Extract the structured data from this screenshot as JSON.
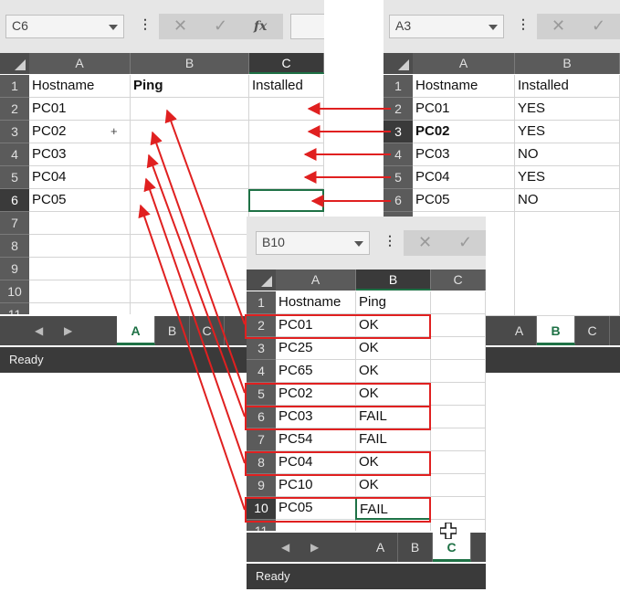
{
  "status_text": "Ready",
  "formula_icons": {
    "cancel": "✕",
    "enter": "✓",
    "fx": "fx"
  },
  "accent_color": "#1e7145",
  "arrow_color": "#e02020",
  "windows": {
    "A": {
      "name_box": "C6",
      "columns": [
        "A",
        "B",
        "C"
      ],
      "selected_column": "C",
      "rows": [
        {
          "num": "1",
          "cells": [
            "Hostname",
            "Ping",
            "Installed"
          ]
        },
        {
          "num": "2",
          "cells": [
            "PC01",
            "",
            ""
          ]
        },
        {
          "num": "3",
          "cells": [
            "PC02",
            "",
            ""
          ]
        },
        {
          "num": "4",
          "cells": [
            "PC03",
            "",
            ""
          ]
        },
        {
          "num": "5",
          "cells": [
            "PC04",
            "",
            ""
          ]
        },
        {
          "num": "6",
          "cells": [
            "PC05",
            "",
            ""
          ]
        },
        {
          "num": "7",
          "cells": [
            "",
            "",
            ""
          ]
        },
        {
          "num": "8",
          "cells": [
            "",
            "",
            ""
          ]
        },
        {
          "num": "9",
          "cells": [
            "",
            "",
            ""
          ]
        },
        {
          "num": "10",
          "cells": [
            "",
            "",
            ""
          ]
        },
        {
          "num": "11",
          "cells": [
            "",
            "",
            ""
          ]
        }
      ],
      "tabs": [
        "A",
        "B",
        "C"
      ],
      "active_tab": "A"
    },
    "B": {
      "name_box": "A3",
      "columns": [
        "A",
        "B"
      ],
      "rows": [
        {
          "num": "1",
          "cells": [
            "Hostname",
            "Installed"
          ]
        },
        {
          "num": "2",
          "cells": [
            "PC01",
            "YES"
          ]
        },
        {
          "num": "3",
          "cells": [
            "PC02",
            "YES"
          ]
        },
        {
          "num": "4",
          "cells": [
            "PC03",
            "NO"
          ]
        },
        {
          "num": "5",
          "cells": [
            "PC04",
            "YES"
          ]
        },
        {
          "num": "6",
          "cells": [
            "PC05",
            "NO"
          ]
        }
      ],
      "tabs": [
        "A",
        "B",
        "C"
      ],
      "active_tab": "B"
    },
    "C": {
      "name_box": "B10",
      "columns": [
        "A",
        "B",
        "C"
      ],
      "selected_column": "B",
      "rows": [
        {
          "num": "1",
          "cells": [
            "Hostname",
            "Ping"
          ]
        },
        {
          "num": "2",
          "cells": [
            "PC01",
            "OK"
          ]
        },
        {
          "num": "3",
          "cells": [
            "PC25",
            "OK"
          ]
        },
        {
          "num": "4",
          "cells": [
            "PC65",
            "OK"
          ]
        },
        {
          "num": "5",
          "cells": [
            "PC02",
            "OK"
          ]
        },
        {
          "num": "6",
          "cells": [
            "PC03",
            "FAIL"
          ]
        },
        {
          "num": "7",
          "cells": [
            "PC54",
            "FAIL"
          ]
        },
        {
          "num": "8",
          "cells": [
            "PC04",
            "OK"
          ]
        },
        {
          "num": "9",
          "cells": [
            "PC10",
            "OK"
          ]
        },
        {
          "num": "10",
          "cells": [
            "PC05",
            "FAIL"
          ]
        },
        {
          "num": "11",
          "cells": [
            "",
            ""
          ]
        }
      ],
      "tabs": [
        "A",
        "B",
        "C"
      ],
      "active_tab": "C"
    }
  }
}
